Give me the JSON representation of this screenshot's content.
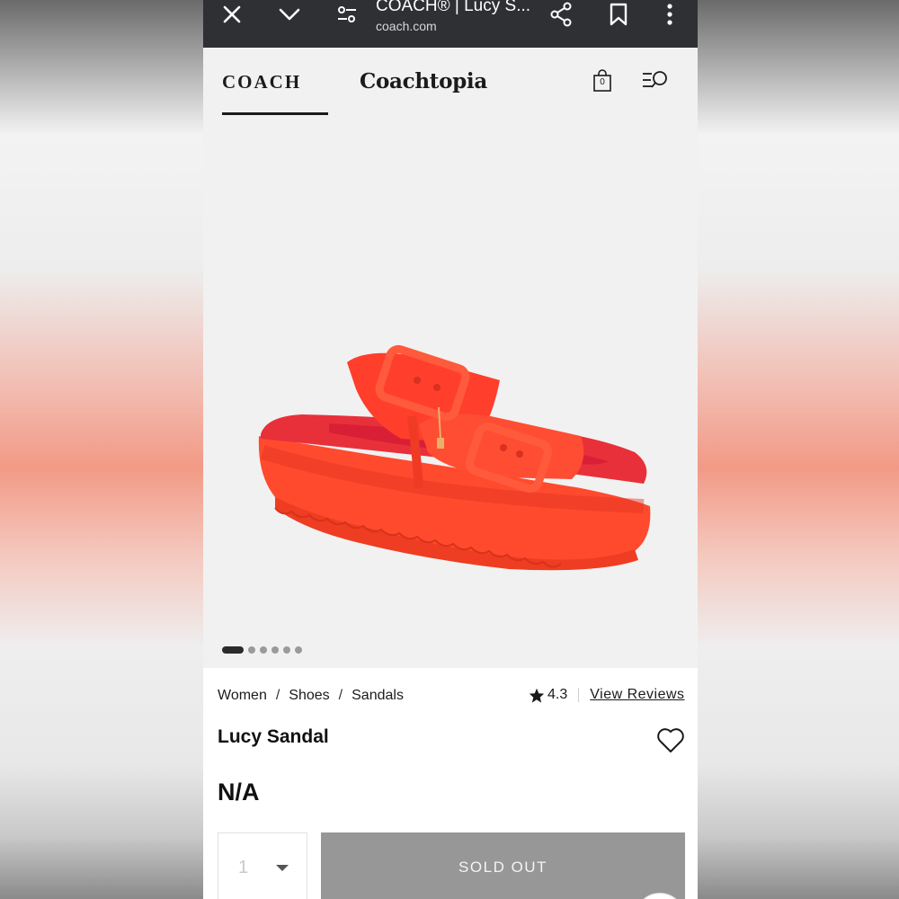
{
  "browser": {
    "title": "COACH® | Lucy S...",
    "url": "coach.com",
    "icons": [
      "close-icon",
      "chevron-down-icon",
      "tune-icon",
      "share-icon",
      "bookmark-icon",
      "more-vert-icon"
    ]
  },
  "header": {
    "logo": "COACH",
    "sub_brand": "Coachtopia",
    "bag_count": "0"
  },
  "gallery": {
    "image_count": 6,
    "active_index": 0
  },
  "product": {
    "breadcrumb": [
      "Women",
      "Shoes",
      "Sandals"
    ],
    "breadcrumb_separator": "/",
    "rating": "4.3",
    "reviews_link": "View Reviews",
    "name": "Lucy Sandal",
    "price": "N/A",
    "quantity": "1",
    "button": "SOLD OUT"
  },
  "colors": {
    "sandal": "#ff4a2e",
    "browser_bar": "#2f3033",
    "soldout_button": "#979797"
  }
}
